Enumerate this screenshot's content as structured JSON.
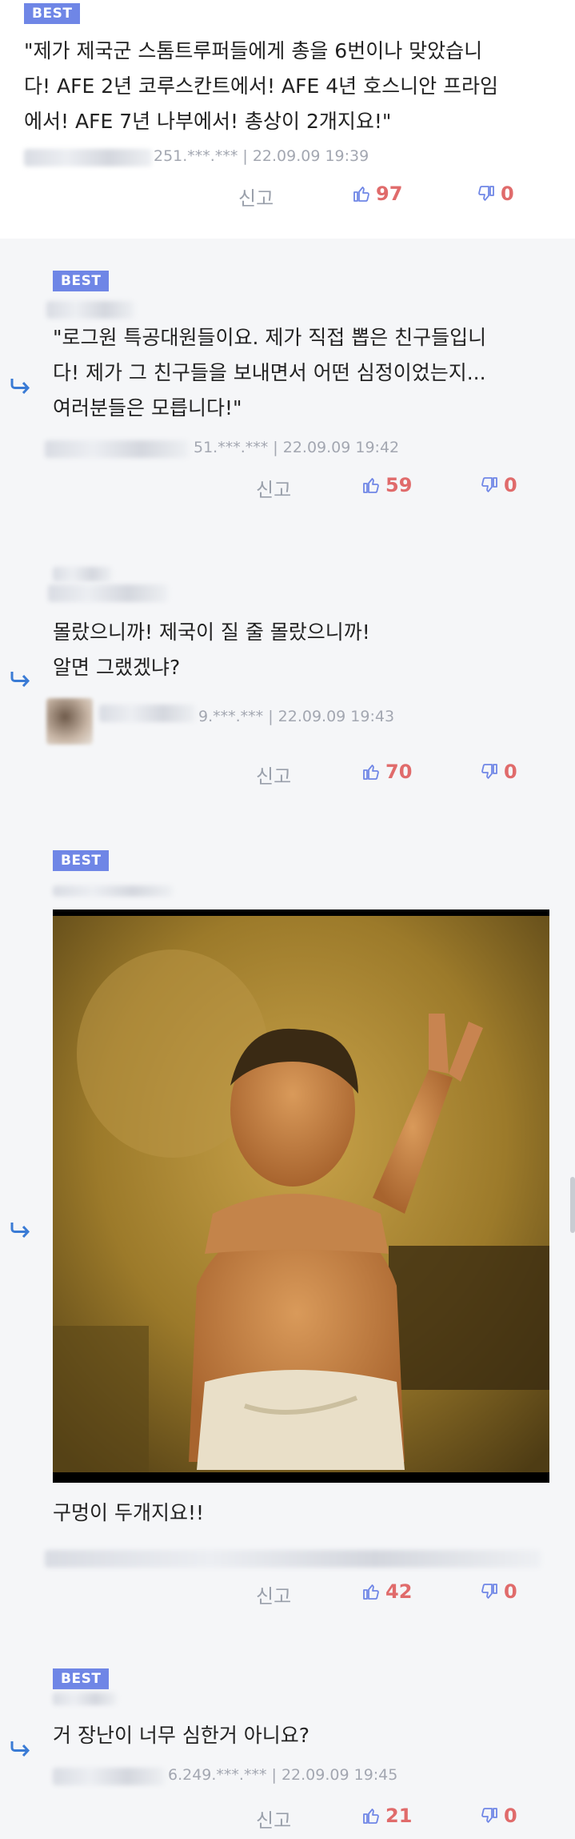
{
  "labels": {
    "best": "BEST",
    "report": "신고"
  },
  "colors": {
    "best_badge": "#6f86e6",
    "vote_count": "#e06b6b",
    "reply_arrow": "#3a7bd5"
  },
  "icons": {
    "reply": "reply-arrow-icon",
    "like": "thumbs-up-icon",
    "dislike": "thumbs-down-icon"
  },
  "comments": [
    {
      "text": "\"제가 제국군 스톰트루퍼들에게 총을 6번이나 맞았습니\n다! AFE 2년 코루스칸트에서! AFE 4년 호스니안 프라임\n에서! AFE 7년 나부에서! 총상이 2개지요!\"",
      "meta": "251.***.*** | 22.09.09 19:39",
      "likes": "97",
      "dislikes": "0"
    },
    {
      "text": "\"로그원 특공대원들이요. 제가 직접 뽑은 친구들입니\n다! 제가 그 친구들을 보내면서 어떤 심정이었는지...\n여러분들은 모릅니다!\"",
      "meta": "51.***.*** | 22.09.09 19:42",
      "likes": "59",
      "dislikes": "0"
    },
    {
      "text": "몰랐으니까! 제국이 질 줄 몰랐으니까!\n알면 그랬겠냐?",
      "meta": "9.***.*** | 22.09.09 19:43",
      "likes": "70",
      "dislikes": "0"
    },
    {
      "text": "구멍이 두개지요!!",
      "meta": "",
      "likes": "42",
      "dislikes": "0"
    },
    {
      "text": "거 장난이 너무 심한거 아니요?",
      "meta": "6.249.***.*** | 22.09.09 19:45",
      "likes": "21",
      "dislikes": "0"
    }
  ]
}
